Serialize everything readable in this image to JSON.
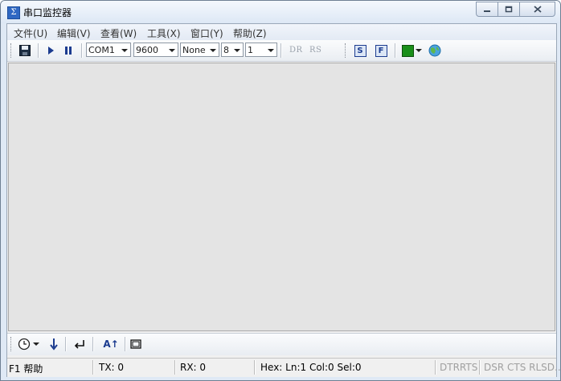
{
  "window": {
    "title": "串口监控器"
  },
  "menu": [
    "文件(U)",
    "编辑(V)",
    "查看(W)",
    "工具(X)",
    "窗口(Y)",
    "帮助(Z)"
  ],
  "toolbar": {
    "port": "COM1",
    "baud": "9600",
    "parity": "None",
    "databits": "8",
    "stopbits": "1",
    "dr_label": "DR",
    "rs_label": "RS",
    "s_label": "S",
    "f_label": "F",
    "color": "#1a8f1a"
  },
  "bottom": {
    "font_label": "A↑"
  },
  "status": {
    "help": "F1 帮助",
    "tx": "TX: 0",
    "rx": "RX: 0",
    "hex": "Hex: Ln:1  Col:0  Sel:0",
    "dtrrts": "DTRRTS",
    "dsr": "DSR CTS RLSD..."
  }
}
